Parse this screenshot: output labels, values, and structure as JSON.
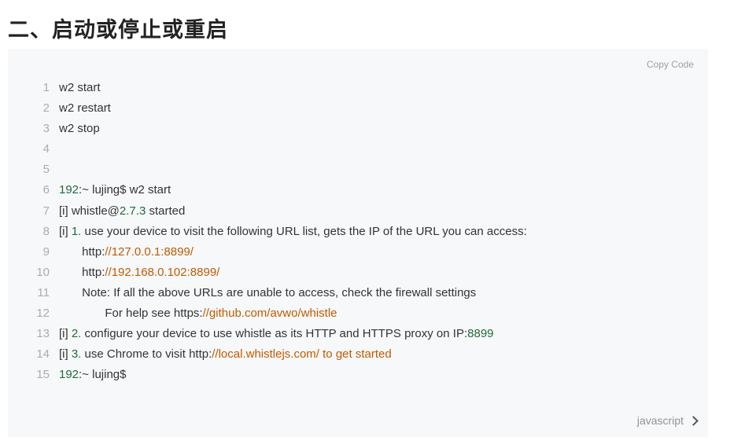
{
  "heading": "二、启动或停止或重启",
  "code_block": {
    "copy_label": "Copy Code",
    "language_label": "javascript",
    "colors": {
      "background": "#f7f8fa",
      "number": "#1f6b3a",
      "string": "#c05b00",
      "line_number": "#a8adb3",
      "text": "#333333"
    },
    "lines": [
      {
        "n": "1",
        "segments": [
          {
            "t": "w2 start",
            "c": "plain"
          }
        ]
      },
      {
        "n": "2",
        "segments": [
          {
            "t": "w2 restart",
            "c": "plain"
          }
        ]
      },
      {
        "n": "3",
        "segments": [
          {
            "t": "w2 stop",
            "c": "plain"
          }
        ]
      },
      {
        "n": "4",
        "segments": []
      },
      {
        "n": "5",
        "segments": []
      },
      {
        "n": "6",
        "segments": [
          {
            "t": "192",
            "c": "num"
          },
          {
            "t": ":~ lujing$ w2 start",
            "c": "plain"
          }
        ]
      },
      {
        "n": "7",
        "segments": [
          {
            "t": "[i] whistle@",
            "c": "plain"
          },
          {
            "t": "2.7.3",
            "c": "num"
          },
          {
            "t": " started",
            "c": "plain"
          }
        ]
      },
      {
        "n": "8",
        "segments": [
          {
            "t": "[i] ",
            "c": "plain"
          },
          {
            "t": "1.",
            "c": "num"
          },
          {
            "t": " use your device to visit the following URL list, gets the IP of the URL you can access:",
            "c": "plain"
          }
        ]
      },
      {
        "n": "9",
        "segments": [
          {
            "t": "       http:",
            "c": "plain"
          },
          {
            "t": "//127.0.0.1:8899/",
            "c": "str"
          }
        ]
      },
      {
        "n": "10",
        "segments": [
          {
            "t": "       http:",
            "c": "plain"
          },
          {
            "t": "//192.168.0.102:8899/",
            "c": "str"
          }
        ]
      },
      {
        "n": "11",
        "segments": [
          {
            "t": "       Note: If all the above URLs are unable to access, check the firewall settings",
            "c": "plain"
          }
        ]
      },
      {
        "n": "12",
        "segments": [
          {
            "t": "              For help see https:",
            "c": "plain"
          },
          {
            "t": "//github.com/avwo/whistle",
            "c": "str"
          }
        ]
      },
      {
        "n": "13",
        "segments": [
          {
            "t": "[i] ",
            "c": "plain"
          },
          {
            "t": "2.",
            "c": "num"
          },
          {
            "t": " configure your device to use whistle as its HTTP and HTTPS proxy on IP:",
            "c": "plain"
          },
          {
            "t": "8899",
            "c": "num"
          }
        ]
      },
      {
        "n": "14",
        "segments": [
          {
            "t": "[i] ",
            "c": "plain"
          },
          {
            "t": "3.",
            "c": "num"
          },
          {
            "t": " use Chrome to visit http:",
            "c": "plain"
          },
          {
            "t": "//local.whistlejs.com/ to get started",
            "c": "str"
          }
        ]
      },
      {
        "n": "15",
        "segments": [
          {
            "t": "192",
            "c": "num"
          },
          {
            "t": ":~ lujing$",
            "c": "plain"
          }
        ]
      }
    ]
  }
}
